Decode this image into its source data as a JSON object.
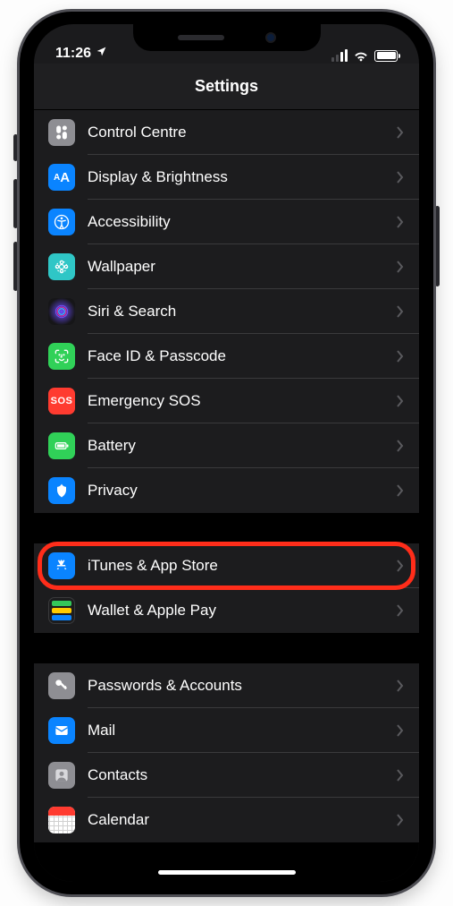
{
  "statusbar": {
    "time": "11:26"
  },
  "header": {
    "title": "Settings"
  },
  "groups": [
    {
      "items": [
        {
          "key": "control",
          "label": "Control Centre"
        },
        {
          "key": "display",
          "label": "Display & Brightness"
        },
        {
          "key": "access",
          "label": "Accessibility"
        },
        {
          "key": "wall",
          "label": "Wallpaper"
        },
        {
          "key": "siri",
          "label": "Siri & Search"
        },
        {
          "key": "face",
          "label": "Face ID & Passcode"
        },
        {
          "key": "sos",
          "label": "Emergency SOS",
          "text_icon": "SOS"
        },
        {
          "key": "batt",
          "label": "Battery"
        },
        {
          "key": "priv",
          "label": "Privacy"
        }
      ]
    },
    {
      "items": [
        {
          "key": "itunes",
          "label": "iTunes & App Store",
          "highlighted": true
        },
        {
          "key": "wallet",
          "label": "Wallet & Apple Pay"
        }
      ]
    },
    {
      "items": [
        {
          "key": "pwd",
          "label": "Passwords & Accounts"
        },
        {
          "key": "mail",
          "label": "Mail"
        },
        {
          "key": "contacts",
          "label": "Contacts"
        },
        {
          "key": "cal",
          "label": "Calendar"
        }
      ]
    }
  ]
}
